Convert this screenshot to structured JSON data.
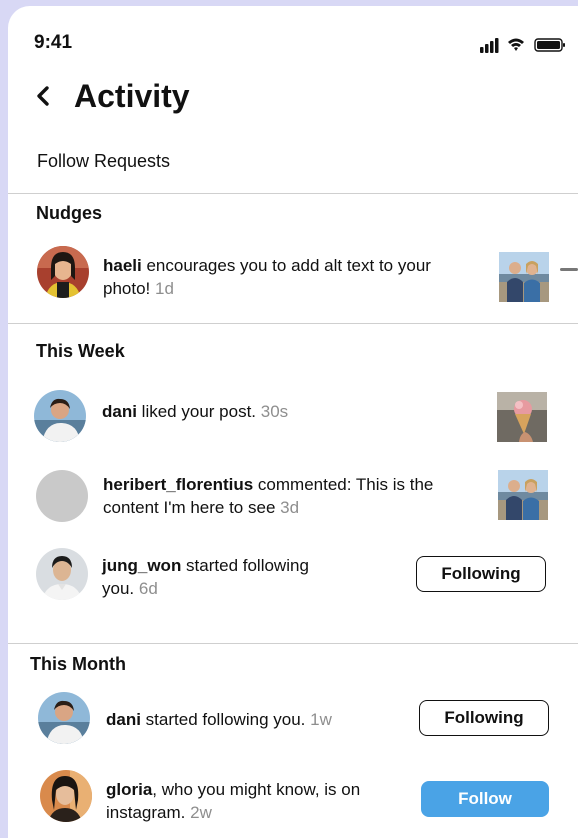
{
  "status_bar": {
    "time": "9:41"
  },
  "header": {
    "title": "Activity"
  },
  "follow_requests": {
    "label": "Follow Requests"
  },
  "sections": {
    "nudges": {
      "title": "Nudges",
      "items": [
        {
          "user": "haeli",
          "message": " encourages you to add alt text to your photo!",
          "time": "1d"
        }
      ]
    },
    "this_week": {
      "title": "This Week",
      "items": [
        {
          "user": "dani",
          "message": " liked your post.",
          "time": "30s"
        },
        {
          "user": "heribert_florentius",
          "message": " commented: This is the content I'm here to see",
          "time": "3d"
        },
        {
          "user": "jung_won",
          "message": " started following you.",
          "time": "6d",
          "button": "Following"
        }
      ]
    },
    "this_month": {
      "title": "This Month",
      "items": [
        {
          "user": "dani",
          "message": " started following you.",
          "time": "1w",
          "button": "Following"
        },
        {
          "user": "gloria",
          "message": ", who you might know, is on instagram.",
          "time": "2w",
          "button": "Follow"
        }
      ]
    }
  },
  "colors": {
    "follow_button": "#4aa3e6",
    "timestamp": "#8e8e8e",
    "divider": "#cfcfcf"
  },
  "icons": [
    "signal-icon",
    "wifi-icon",
    "battery-icon",
    "back-chevron-icon"
  ]
}
